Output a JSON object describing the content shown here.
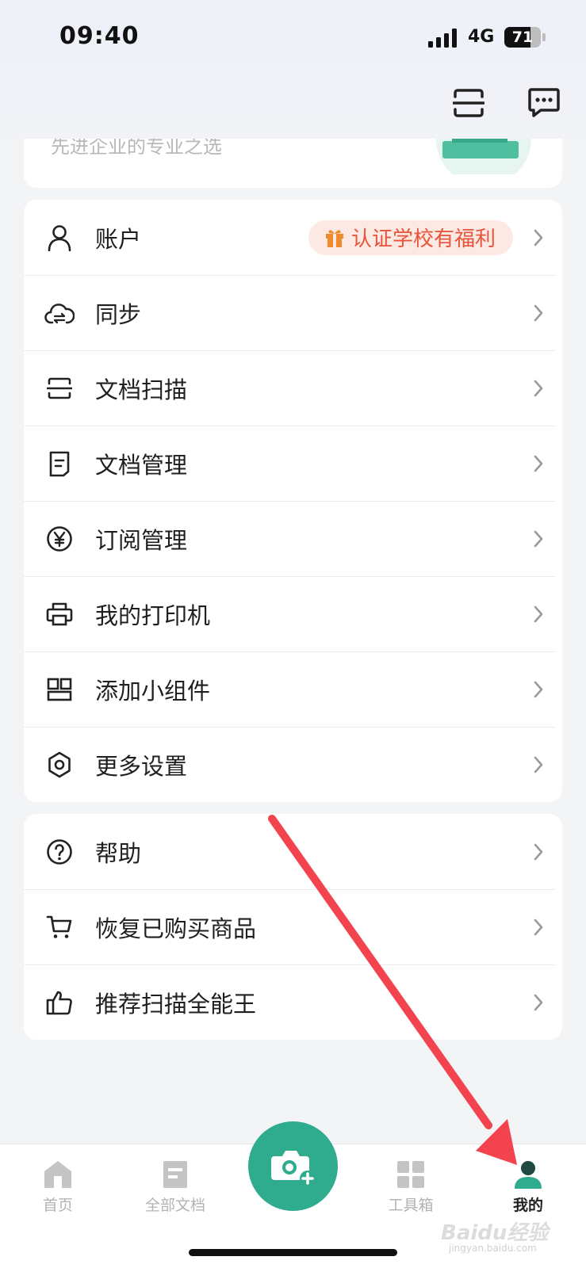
{
  "status_bar": {
    "time": "09:40",
    "network": "4G",
    "battery": "71",
    "battery_level": 0.71
  },
  "promo": {
    "subtitle": "先进企业的专业之选"
  },
  "menu_group_1": [
    {
      "label": "账户",
      "icon": "user-icon",
      "badge": "认证学校有福利"
    },
    {
      "label": "同步",
      "icon": "cloud-sync-icon"
    },
    {
      "label": "文档扫描",
      "icon": "scan-icon"
    },
    {
      "label": "文档管理",
      "icon": "document-icon"
    },
    {
      "label": "订阅管理",
      "icon": "yen-icon"
    },
    {
      "label": "我的打印机",
      "icon": "printer-icon"
    },
    {
      "label": "添加小组件",
      "icon": "widget-icon"
    },
    {
      "label": "更多设置",
      "icon": "gear-icon"
    }
  ],
  "menu_group_2": [
    {
      "label": "帮助",
      "icon": "help-icon"
    },
    {
      "label": "恢复已购买商品",
      "icon": "cart-icon"
    },
    {
      "label": "推荐扫描全能王",
      "icon": "thumbs-up-icon"
    }
  ],
  "tabbar": {
    "home": "首页",
    "docs": "全部文档",
    "tools": "工具箱",
    "mine": "我的"
  },
  "watermark": {
    "brand": "Baidu经验",
    "url": "jingyan.baidu.com"
  },
  "colors": {
    "accent": "#2fab8e",
    "badge_text": "#e8543a",
    "badge_bg": "#fde9e4",
    "annotation_arrow": "#f2434f"
  }
}
